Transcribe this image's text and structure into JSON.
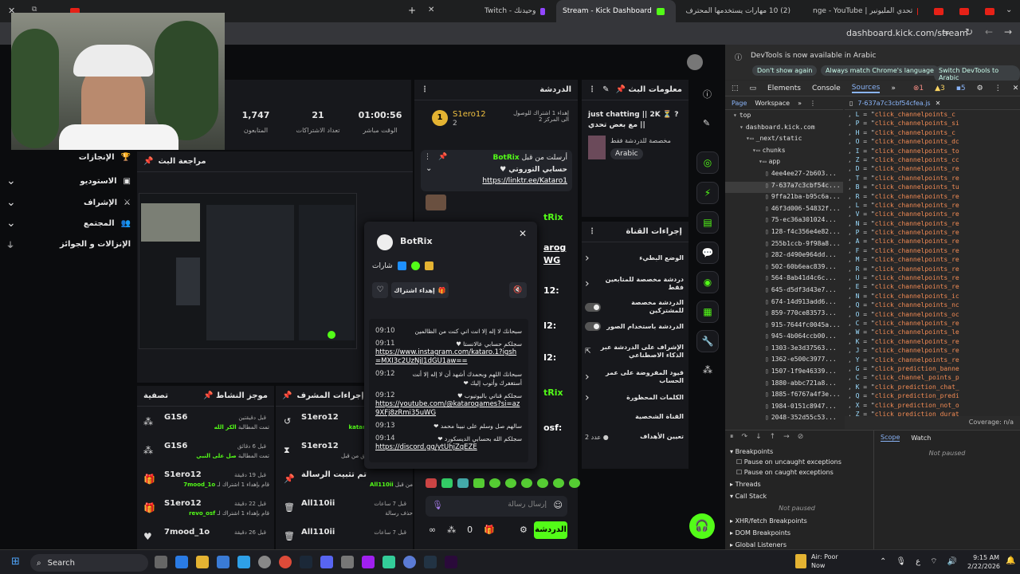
{
  "browser": {
    "tabs": [
      {
        "label": "Twitch - وحيدنك",
        "active": false
      },
      {
        "label": "Stream - Kick Dashboard",
        "active": true
      },
      {
        "label": "(2) 10 مهارات يستخدمها المحترف",
        "active": false
      },
      {
        "label": "تحدي المليونير | nge - YouTube",
        "active": false
      }
    ],
    "url": "dashboard.kick.com/stream"
  },
  "stats": [
    {
      "value": "01:00:56",
      "label": "الوقت مباشر"
    },
    {
      "value": "21",
      "label": "تعداد الاشتراكات"
    },
    {
      "value": "1,747",
      "label": "المتابعون"
    }
  ],
  "left_nav": [
    {
      "label": "الإنجازات"
    },
    {
      "label": "الاستوديو"
    },
    {
      "label": "الإشراف"
    },
    {
      "label": "المجتمع"
    },
    {
      "label": "الإنزالات و الجوائز"
    }
  ],
  "review": {
    "title": "مراجعة البث"
  },
  "activity": {
    "title": "موجز النشاط",
    "filter": "تصفية",
    "items": [
      {
        "name": "G1S6",
        "time": "قبل دقيقتين",
        "desc": "تمت المطالبة",
        "extra": "الكر الله"
      },
      {
        "name": "G1S6",
        "time": "قبل 6 دقائق",
        "desc": "تمت المطالبة",
        "extra": "صل على النبي"
      },
      {
        "name": "S1ero12",
        "time": "قبل 19 دقيقة",
        "desc": "قام بإهداء 1 اشتراك لـ",
        "extra": "7mood_1o"
      },
      {
        "name": "S1ero12",
        "time": "قبل 22 دقيقة",
        "desc": "قام بإهداء 1 اشتراك لـ",
        "extra": "revo_osf"
      },
      {
        "name": "7mood_1o",
        "time": "قبل 26 دقيقة",
        "desc": "",
        "extra": ""
      }
    ]
  },
  "mod_actions": {
    "title": "إجراءات المشرف",
    "items": [
      {
        "name": "S1ero12",
        "desc": "ألغى حظره من قبل",
        "extra": "katar"
      },
      {
        "name": "S1ero12",
        "desc": "قام بكتم لمدة 5 دقائق من قبل",
        "extra": ""
      },
      {
        "name": "تم تثبيت الرسالة",
        "desc": "من قبل",
        "extra": "All110ii"
      },
      {
        "name": "All110ii",
        "desc": "حذف رسالة",
        "time": "قبل 7 ساعات"
      },
      {
        "name": "All110ii",
        "desc": "",
        "time": "قبل 7 ساعات"
      }
    ]
  },
  "chat": {
    "title": "الدردشة",
    "top_gifter": {
      "name": "S1ero12",
      "count": "2",
      "note": "إهداء 1 اشتراك للوصول الى المركز 2"
    },
    "pinned": {
      "by": "أرسلت من قبل",
      "user": "BotRix",
      "text": "حسابي التوروتي ♥",
      "link": "https://linktr.ee/Kataro1"
    },
    "placeholder": "إرسال رسالة",
    "send_label": "الدردشة",
    "bg_names": [
      "tRix",
      "arog",
      "WG",
      "12:",
      "I2:",
      "I2:",
      "tRix",
      "osf:"
    ]
  },
  "user_card": {
    "name": "BotRix",
    "badges_label": "شارات",
    "gift_label": "إهداء اشتراك",
    "messages": [
      {
        "time": "09:10",
        "text": "سبحانك لا إله إلا انت اني كنت من الظالمين"
      },
      {
        "time": "09:11",
        "text": "سجلكم حسابي عالانستا ♥",
        "link": "https://www.instagram.com/kataro.1?igsh=MXI3c2UzNjJ1dGU1aw=="
      },
      {
        "time": "09:12",
        "text": "سبحانك اللهم وبحمدك أشهد أن لا إله إلا أنت أستغفرك وأتوب إليك ❤"
      },
      {
        "time": "09:12",
        "text": "سجلكم قناتي باليوتيوب ♥",
        "link": "https://youtube.com/@kataroqames?si=az9XFj8zRmi35uWG"
      },
      {
        "time": "09:13",
        "text": "سالهم صل وسلم على نبينا محمد ❤"
      },
      {
        "time": "09:14",
        "text": "سجلكم الله بحسابي الديسكورد ❤",
        "link": "https://discord.gg/ytUhjZqEZE"
      }
    ]
  },
  "stream_info": {
    "title": "معلومات البث",
    "stream_title": "just chatting || 2K ⏳ ?مع بعض تحدي ||",
    "subtitle": "مخصصة للدردشة فقط",
    "language": "Arabic"
  },
  "channel_actions": {
    "title": "إجراءات القناة",
    "items": [
      {
        "label": "الوضع البطيء",
        "kind": "chevron"
      },
      {
        "label": "دردشة مخصصة للمتابعين فقط",
        "kind": "chevron"
      },
      {
        "label": "الدردشة مخصصة للمشتركين",
        "kind": "toggle"
      },
      {
        "label": "الدردشة باستخدام الصور",
        "kind": "toggle"
      },
      {
        "label": "الإشراف على الدردشة عبر الذكاء الاصطناعي",
        "kind": "link"
      },
      {
        "label": "قيود المفروضة على عمر الحساب",
        "kind": "chevron"
      },
      {
        "label": "الكلمات المحظورة",
        "kind": "chevron"
      },
      {
        "label": "القناة الشخصية",
        "kind": "none"
      },
      {
        "label": "تعيين الأهداف",
        "kind": "goal",
        "extra": "عدد 2"
      }
    ]
  },
  "devtools": {
    "notice": "DevTools is now available in Arabic",
    "btn1": "Don't show again",
    "btn2": "Always match Chrome's language",
    "btn3": "Switch DevTools to Arabic",
    "tabs": [
      "Elements",
      "Console",
      "Sources"
    ],
    "subtabs": [
      "Page",
      "Workspace"
    ],
    "file_tab": "7-637a7c3cbf54cfea.js",
    "errors": "1",
    "warnings": "3",
    "info": "5",
    "tree": [
      "top",
      "dashboard.kick.com",
      "_next/static",
      "chunks",
      "app",
      "4ee4ee27-2b603...",
      "7-637a7c3cbf54c...",
      "9ffa21ba-b95c6a...",
      "46f3d006-54832f...",
      "75-ec36a301024...",
      "128-f4c356e4e82...",
      "255b1ccb-9f98a8...",
      "282-d490e964dd...",
      "502-60b6eac839...",
      "564-8ab41d4c6c...",
      "645-d5df3d43e7...",
      "674-14d913add6...",
      "859-770ce83573...",
      "915-7644fc0045a...",
      "945-4b064ccb00...",
      "1303-3e3d37563...",
      "1362-e500c3977...",
      "1507-1f9e46339...",
      "1880-abbc721a8...",
      "1885-f6767a4f3e...",
      "1984-0151c8947...",
      "2048-352d55c53..."
    ],
    "code_keys": [
      "L",
      "P",
      "H",
      "O",
      "I",
      "Z",
      "D",
      "T",
      "B",
      "R",
      "L",
      "V",
      "N",
      "P",
      "A",
      "F",
      "M",
      "R",
      "U",
      "E",
      "N",
      "Q",
      "O",
      "C",
      "W",
      "K",
      "J",
      "Y",
      "G",
      "C",
      "K",
      "Q",
      "X",
      "Z"
    ],
    "code_vals": [
      "click_channelpoints_c",
      "click_channelpoints_si",
      "click_channelpoints_c",
      "click_channelpoints_dc",
      "click_channelpoints_to",
      "click_channelpoints_cc",
      "click_channelpoints_re",
      "click_channelpoints_re",
      "click_channelpoints_tu",
      "click_channelpoints_re",
      "click_channelpoints_re",
      "click_channelpoints_re",
      "click_channelpoints_re",
      "click_channelpoints_re",
      "click_channelpoints_re",
      "click_channelpoints_re",
      "click_channelpoints_re",
      "click_channelpoints_re",
      "click_channelpoints_re",
      "click_channelpoints_re",
      "click_channelpoints_ic",
      "click_channelpoints_nc",
      "click_channelpoints_oc",
      "click_channelpoints_re",
      "click_channelpoints_le",
      "click_channelpoints_re",
      "click_channelpoints_re",
      "click_channelpoints_re",
      "click_prediction_banne",
      "click_channel_points_p",
      "click_prediction_chat_",
      "click_prediction_predi",
      "click_prediction_not_o",
      "click_prediction_durat"
    ],
    "coverage": "Coverage: n/a",
    "debug": {
      "breakpoints": "Breakpoints",
      "pause_uncaught": "Pause on uncaught exceptions",
      "pause_caught": "Pause on caught exceptions",
      "threads": "Threads",
      "callstack": "Call Stack",
      "not_paused": "Not paused",
      "xhr": "XHR/fetch Breakpoints",
      "dom": "DOM Breakpoints",
      "global": "Global Listeners",
      "scope": "Scope",
      "watch": "Watch",
      "scope_not_paused": "Not paused"
    }
  },
  "taskbar": {
    "search": "Search",
    "air": "Air: Poor",
    "air_sub": "Now",
    "time": "9:15 AM",
    "date": "2/22/2026",
    "lang": "ع"
  },
  "colors": {
    "accent": "#53fc18",
    "panel": "#17181c"
  }
}
